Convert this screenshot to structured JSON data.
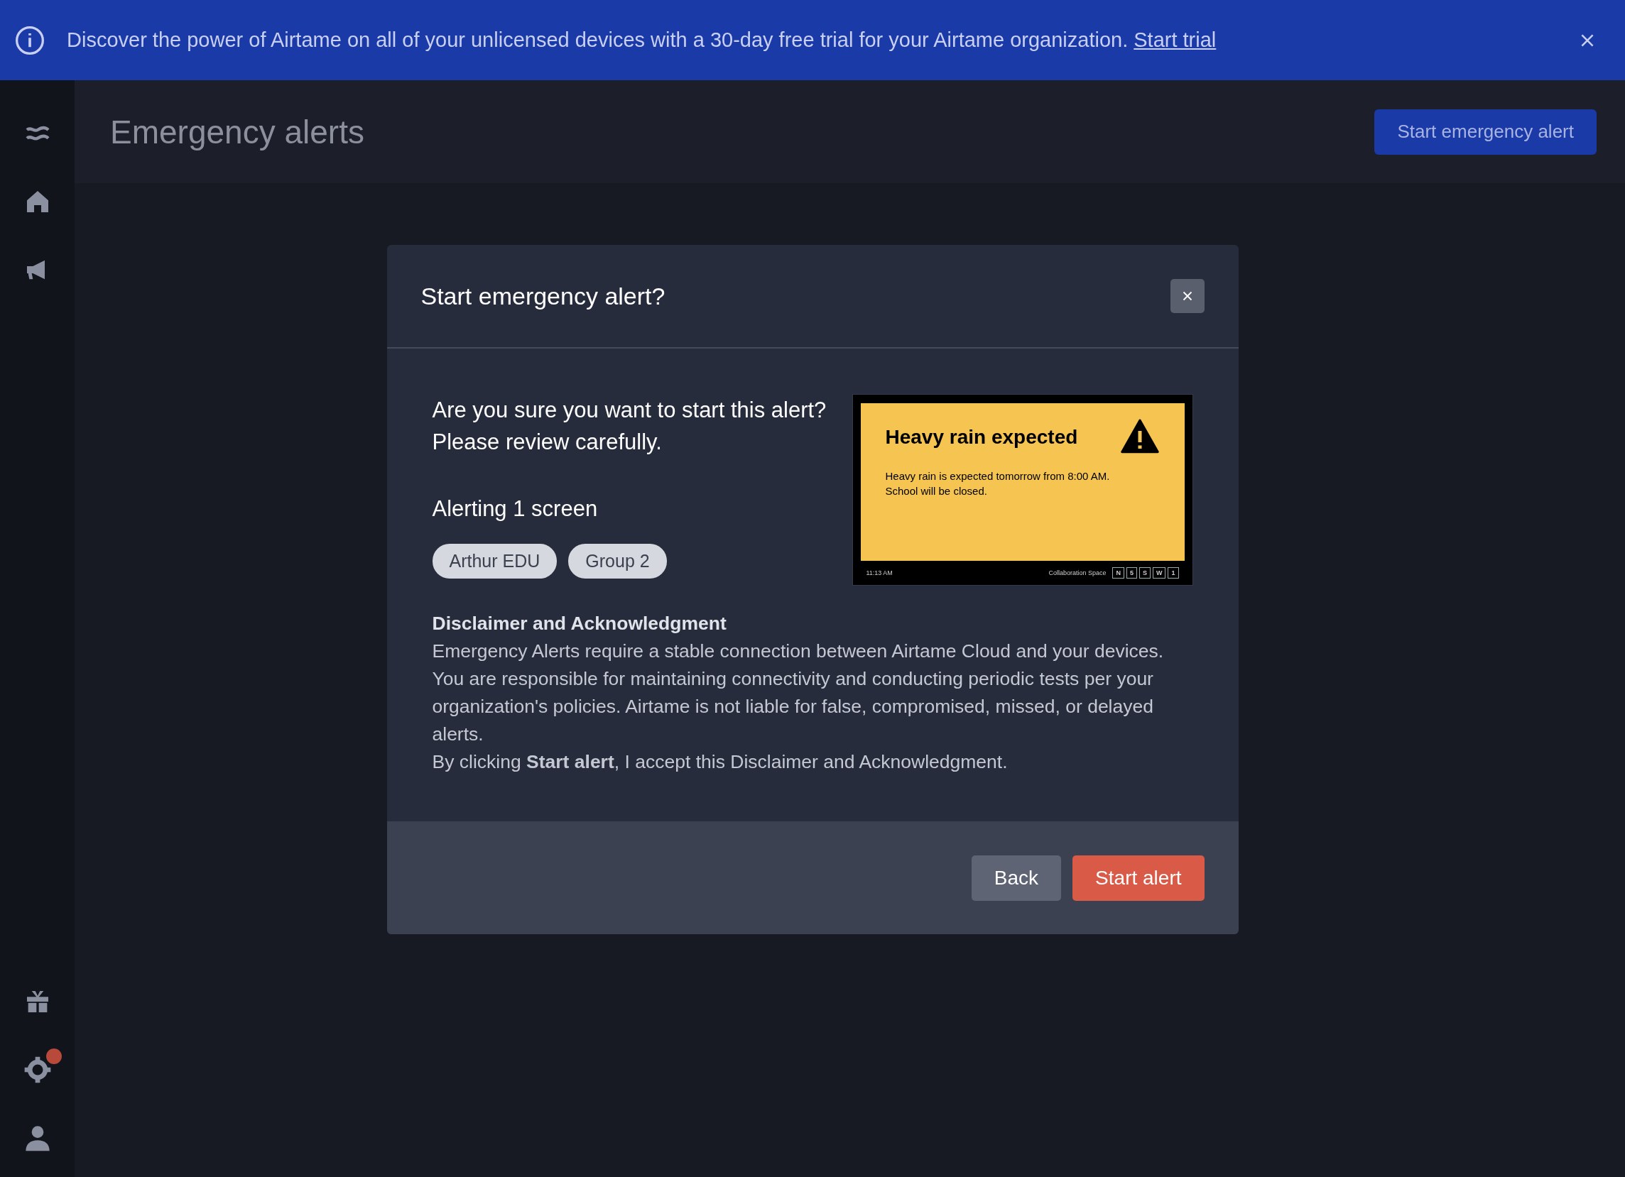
{
  "banner": {
    "message": "Discover the power of Airtame on all of your unlicensed devices with a 30-day free trial for your Airtame organization.",
    "link": "Start trial"
  },
  "sidebar": {
    "top": [
      {
        "kind": "logo"
      },
      {
        "kind": "home"
      },
      {
        "kind": "megaphone"
      }
    ],
    "bottom": [
      {
        "kind": "gift",
        "badge": false
      },
      {
        "kind": "gear",
        "badge": true
      },
      {
        "kind": "person",
        "badge": false
      }
    ]
  },
  "header": {
    "title": "Emergency alerts",
    "button": "Start emergency alert"
  },
  "modal": {
    "title": "Start emergency alert?",
    "question": [
      "Are you sure you want to start this alert?",
      "Please review carefully."
    ],
    "alerting": "Alerting 1 screen",
    "tags": [
      "Arthur EDU",
      "Group 2"
    ],
    "preview": {
      "title": "Heavy rain expected",
      "body": [
        "Heavy rain is expected tomorrow from 8:00 AM.",
        "School will be closed."
      ],
      "time": "11:13 AM",
      "location": "Collaboration Space",
      "keys": [
        "N",
        "5",
        "S",
        "W",
        "1"
      ]
    },
    "disclaimer": {
      "heading": "Disclaimer and Acknowledgment",
      "paragraph": "Emergency Alerts require a stable connection between Airtame Cloud and your devices. You are responsible for maintaining connectivity and conducting periodic tests per your organization's policies. Airtame is not liable for false, compromised, missed, or delayed alerts.",
      "acceptance": "By clicking **Start alert**, I accept this Disclaimer and Acknowledgment."
    },
    "buttons": [
      {
        "kind": "secondary",
        "label": "Back"
      },
      {
        "kind": "primary",
        "label": "Start alert"
      }
    ]
  }
}
